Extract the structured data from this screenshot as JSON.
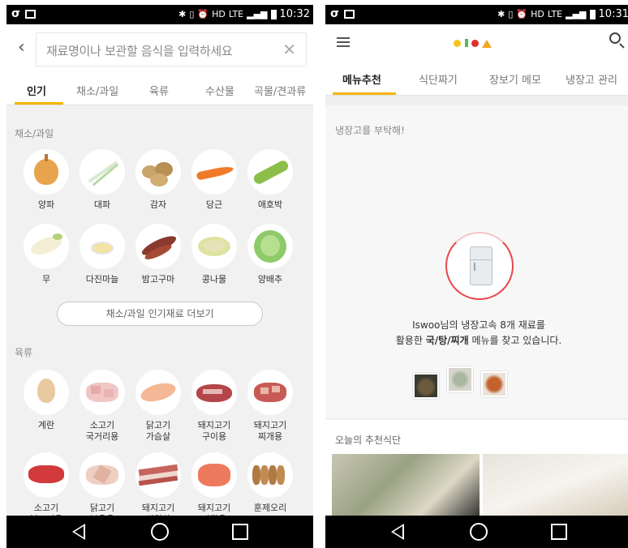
{
  "left_screen": {
    "status_bar": {
      "time": "10:32",
      "network": "LTE"
    },
    "search": {
      "placeholder": "재료명이나 보관할 음식을 입력하세요"
    },
    "tabs": [
      {
        "label": "인기",
        "active": true
      },
      {
        "label": "채소/과일",
        "active": false
      },
      {
        "label": "육류",
        "active": false
      },
      {
        "label": "수산물",
        "active": false
      },
      {
        "label": "곡물/견과류",
        "active": false
      }
    ],
    "vegetables": {
      "title": "채소/과일",
      "items": [
        {
          "label": "양파",
          "icon": "onion-icon"
        },
        {
          "label": "대파",
          "icon": "green-onion-icon"
        },
        {
          "label": "감자",
          "icon": "potato-icon"
        },
        {
          "label": "당근",
          "icon": "carrot-icon"
        },
        {
          "label": "애호박",
          "icon": "zucchini-icon"
        },
        {
          "label": "무",
          "icon": "radish-icon"
        },
        {
          "label": "다진마늘",
          "icon": "minced-garlic-icon"
        },
        {
          "label": "밤고구마",
          "icon": "sweet-potato-icon"
        },
        {
          "label": "콩나물",
          "icon": "bean-sprout-icon"
        },
        {
          "label": "양배추",
          "icon": "cabbage-icon"
        }
      ],
      "more_label": "채소/과일 인기재료 더보기"
    },
    "meats": {
      "title": "육류",
      "items": [
        {
          "label": "계란",
          "icon": "egg-icon"
        },
        {
          "label": "소고기\n국거리용",
          "icon": "beef-soup-icon"
        },
        {
          "label": "닭고기\n가슴살",
          "icon": "chicken-breast-icon"
        },
        {
          "label": "돼지고기\n구이용",
          "icon": "pork-grill-icon"
        },
        {
          "label": "돼지고기\n찌개용",
          "icon": "pork-stew-icon"
        },
        {
          "label": "소고기\n불고기용",
          "icon": "beef-bulgogi-icon"
        },
        {
          "label": "닭고기\n볶음용",
          "icon": "chicken-stirfry-icon"
        },
        {
          "label": "돼지고기\n삼겹살",
          "icon": "pork-belly-icon"
        },
        {
          "label": "돼지고기\n다짐육",
          "icon": "ground-pork-icon"
        },
        {
          "label": "훈제오리",
          "icon": "smoked-duck-icon"
        }
      ]
    }
  },
  "right_screen": {
    "status_bar": {
      "time": "10:31",
      "network": "LTE"
    },
    "tabs": [
      {
        "label": "메뉴추천",
        "active": true
      },
      {
        "label": "식단짜기",
        "active": false
      },
      {
        "label": "장보기 메모",
        "active": false
      },
      {
        "label": "냉장고 관리",
        "active": false
      }
    ],
    "fridge_card": {
      "title": "냉장고를 부탁해!",
      "line1": "Iswoo님의 냉장고속 8개 재료를",
      "line2_prefix": "활용한 ",
      "line2_bold": "국/탕/찌개",
      "line2_suffix": " 메뉴를 찾고 있습니다."
    },
    "recommend": {
      "title": "오늘의 추천식단"
    }
  },
  "colors": {
    "accent": "#f4b400",
    "ring": "#e8474a"
  }
}
